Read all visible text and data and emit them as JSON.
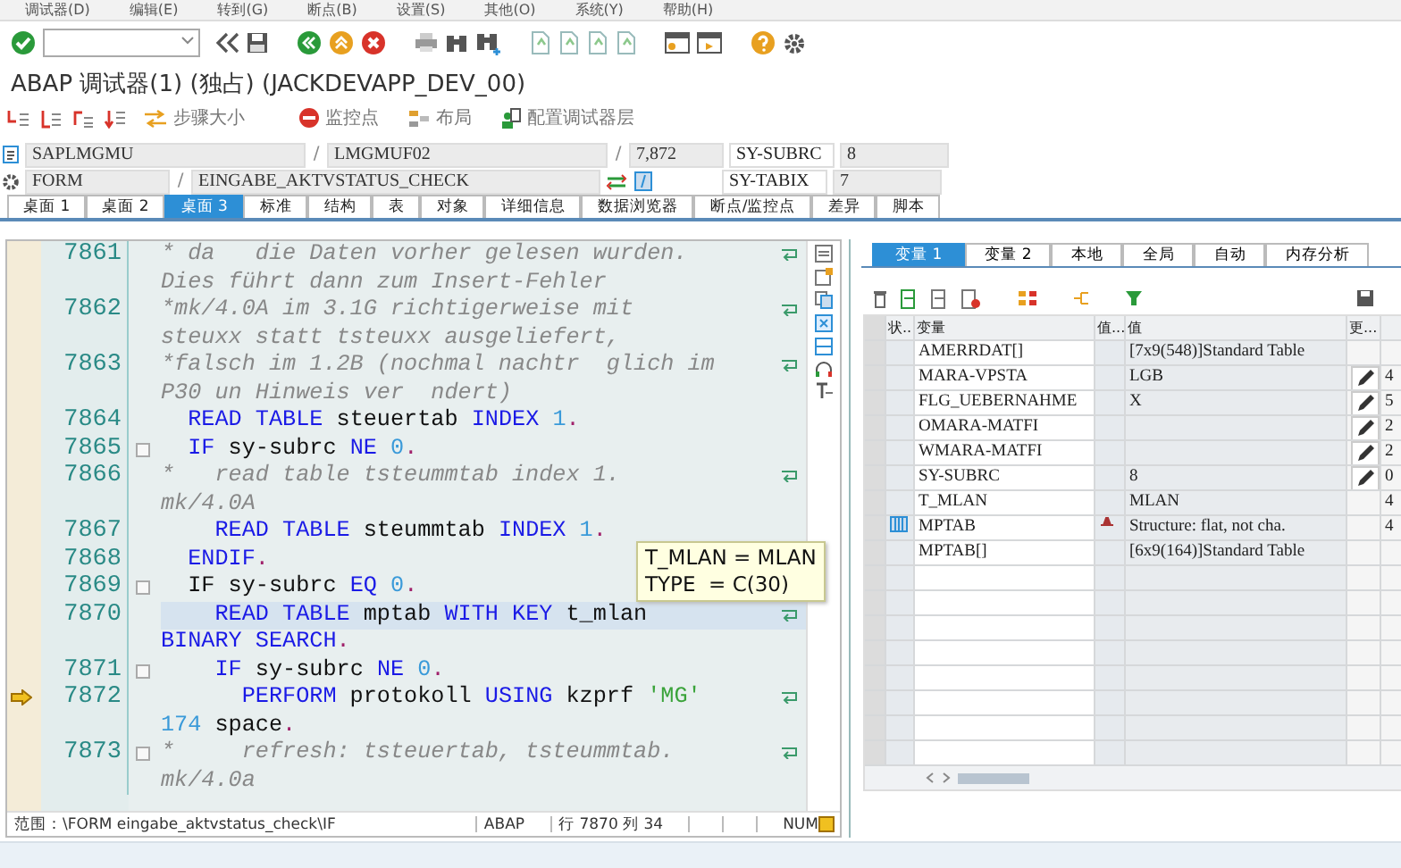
{
  "menu": [
    "调试器(D)",
    "编辑(E)",
    "转到(G)",
    "断点(B)",
    "设置(S)",
    "其他(O)",
    "系统(Y)",
    "帮助(H)"
  ],
  "title": "ABAP 调试器(1) (独占) (JACKDEVAPP_DEV_00)",
  "app_toolbar": [
    {
      "label": "步骤大小"
    },
    {
      "label": "监控点"
    },
    {
      "label": "布局"
    },
    {
      "label": "配置调试器层"
    }
  ],
  "program_info": {
    "program": "SAPLMGMU",
    "separator_1": "/",
    "include": "LMGMUF02",
    "separator_2": "/",
    "line": "7,872",
    "event_type": "FORM",
    "separator_3": "/",
    "event": "EINGABE_AKTVSTATUS_CHECK"
  },
  "sy_fields": [
    {
      "name": "SY-SUBRC",
      "value": "8"
    },
    {
      "name": "SY-TABIX",
      "value": "7"
    }
  ],
  "desktop_tabs": [
    {
      "label": "桌面 1",
      "selected": false
    },
    {
      "label": "桌面 2",
      "selected": false
    },
    {
      "label": "桌面 3",
      "selected": true
    },
    {
      "label": "标准",
      "selected": false
    },
    {
      "label": "结构",
      "selected": false
    },
    {
      "label": "表",
      "selected": false
    },
    {
      "label": "对象",
      "selected": false
    },
    {
      "label": "详细信息",
      "selected": false
    },
    {
      "label": "数据浏览器",
      "selected": false
    },
    {
      "label": "断点/监控点",
      "selected": false
    },
    {
      "label": "差异",
      "selected": false
    },
    {
      "label": "脚本",
      "selected": false
    }
  ],
  "editor": {
    "lines": [
      {
        "number": "7861",
        "selected": false,
        "current": false,
        "fold": false,
        "segments": [
          {
            "kind": "comment",
            "text": "* da   die Daten vorher gelesen wurden.\nDies führt dann zum Insert-Fehler"
          }
        ]
      },
      {
        "number": "7862",
        "selected": false,
        "current": false,
        "fold": false,
        "segments": [
          {
            "kind": "comment",
            "text": "*mk/4.0A im 3.1G richtigerweise mit\nsteuxx statt tsteuxx ausgeliefert,"
          }
        ]
      },
      {
        "number": "7863",
        "selected": false,
        "current": false,
        "fold": false,
        "segments": [
          {
            "kind": "comment",
            "text": "*falsch im 1.2B (nochmal nachtr  glich im\nP30 un Hinweis ver  ndert)"
          }
        ]
      },
      {
        "number": "7864",
        "selected": false,
        "current": false,
        "fold": false,
        "segments": [
          {
            "kind": "keyword",
            "text": "  READ TABLE"
          },
          {
            "kind": "plain",
            "text": " steuertab "
          },
          {
            "kind": "keyword",
            "text": "INDEX"
          },
          {
            "kind": "number",
            "text": " 1"
          },
          {
            "kind": "dot",
            "text": "."
          }
        ]
      },
      {
        "number": "7865",
        "selected": false,
        "current": false,
        "fold": true,
        "segments": [
          {
            "kind": "keyword",
            "text": "  IF"
          },
          {
            "kind": "plain",
            "text": " sy-subrc "
          },
          {
            "kind": "keyword",
            "text": "NE"
          },
          {
            "kind": "number",
            "text": " 0"
          },
          {
            "kind": "dot",
            "text": "."
          }
        ]
      },
      {
        "number": "7866",
        "selected": false,
        "current": false,
        "fold": false,
        "segments": [
          {
            "kind": "comment",
            "text": "*   read table tsteummtab index 1.\nmk/4.0A"
          }
        ]
      },
      {
        "number": "7867",
        "selected": false,
        "current": false,
        "fold": false,
        "segments": [
          {
            "kind": "keyword",
            "text": "    READ TABLE"
          },
          {
            "kind": "plain",
            "text": " steummtab "
          },
          {
            "kind": "keyword",
            "text": "INDEX"
          },
          {
            "kind": "number",
            "text": " 1"
          },
          {
            "kind": "dot",
            "text": "."
          }
        ]
      },
      {
        "number": "7868",
        "selected": false,
        "current": false,
        "fold": false,
        "segments": [
          {
            "kind": "keyword",
            "text": "  ENDIF"
          },
          {
            "kind": "dot",
            "text": "."
          }
        ]
      },
      {
        "number": "7869",
        "selected": false,
        "current": false,
        "fold": true,
        "segments": [
          {
            "kind": "plain",
            "text": "  IF sy-subrc "
          },
          {
            "kind": "keyword",
            "text": "EQ"
          },
          {
            "kind": "number",
            "text": " 0"
          },
          {
            "kind": "dot",
            "text": "."
          }
        ]
      },
      {
        "number": "7870",
        "selected": true,
        "current": false,
        "fold": false,
        "segments": [
          {
            "kind": "keyword",
            "text": "    READ TABLE"
          },
          {
            "kind": "plain",
            "text": " mptab "
          },
          {
            "kind": "keyword",
            "text": "WITH KEY"
          },
          {
            "kind": "plain",
            "text": " t_mlan\n"
          },
          {
            "kind": "keyword",
            "text": "BINARY SEARCH"
          },
          {
            "kind": "dot",
            "text": "."
          }
        ]
      },
      {
        "number": "7871",
        "selected": false,
        "current": false,
        "fold": true,
        "segments": [
          {
            "kind": "keyword",
            "text": "    IF"
          },
          {
            "kind": "plain",
            "text": " sy-subrc "
          },
          {
            "kind": "keyword",
            "text": "NE"
          },
          {
            "kind": "number",
            "text": " 0"
          },
          {
            "kind": "dot",
            "text": "."
          }
        ]
      },
      {
        "number": "7872",
        "selected": false,
        "current": true,
        "fold": false,
        "segments": [
          {
            "kind": "keyword",
            "text": "      PERFORM"
          },
          {
            "kind": "plain",
            "text": " protokoll "
          },
          {
            "kind": "keyword",
            "text": "USING"
          },
          {
            "kind": "plain",
            "text": " kzprf "
          },
          {
            "kind": "string",
            "text": "'MG'\n"
          },
          {
            "kind": "number",
            "text": "174"
          },
          {
            "kind": "plain",
            "text": " space"
          },
          {
            "kind": "dot",
            "text": "."
          }
        ]
      },
      {
        "number": "7873",
        "selected": false,
        "current": false,
        "fold": true,
        "segments": [
          {
            "kind": "comment",
            "text": "*     refresh: tsteuertab, tsteummtab.\nmk/4.0a"
          }
        ]
      }
    ],
    "tooltip": [
      "T_MLAN = MLAN",
      "TYPE  = C(30)"
    ],
    "status_bar": {
      "scope_label": "范围：",
      "scope": "\\FORM eingabe_aktvstatus_check\\IF",
      "language": "ABAP",
      "position": "行 7870 列 34",
      "mode": "NUM"
    }
  },
  "variables": {
    "tabs": [
      {
        "label": "变量 1",
        "selected": true
      },
      {
        "label": "变量 2",
        "selected": false
      },
      {
        "label": "本地",
        "selected": false
      },
      {
        "label": "全局",
        "selected": false
      },
      {
        "label": "自动",
        "selected": false
      },
      {
        "label": "内存分析",
        "selected": false
      }
    ],
    "columns": [
      "状...",
      "变量",
      "值...",
      "值",
      "更..."
    ],
    "rows": [
      {
        "kind": "plain",
        "name": "AMERRDAT[]",
        "value": "[7x9(548)]Standard Table",
        "editable": false
      },
      {
        "kind": "plain",
        "name": "MARA-VPSTA",
        "value": "LGB",
        "editable": true,
        "column_6": "4"
      },
      {
        "kind": "plain",
        "name": "FLG_UEBERNAHME",
        "value": "X",
        "editable": true,
        "column_6": "5"
      },
      {
        "kind": "plain",
        "name": "OMARA-MATFI",
        "editable": true,
        "column_6": "2"
      },
      {
        "kind": "plain",
        "name": "WMARA-MATFI",
        "editable": true,
        "column_6": "2"
      },
      {
        "kind": "plain",
        "name": "SY-SUBRC",
        "value": "8",
        "editable": true,
        "column_6": "0"
      },
      {
        "kind": "plain",
        "name": "T_MLAN",
        "value": "MLAN",
        "editable": false,
        "column_6": "4"
      },
      {
        "kind": "structure",
        "name": "MPTAB",
        "value": "Structure: flat, not cha.",
        "editable": false,
        "column_6": "4"
      },
      {
        "kind": "plain",
        "name": "MPTAB[]",
        "value": "[6x9(164)]Standard Table",
        "editable": false
      }
    ]
  }
}
